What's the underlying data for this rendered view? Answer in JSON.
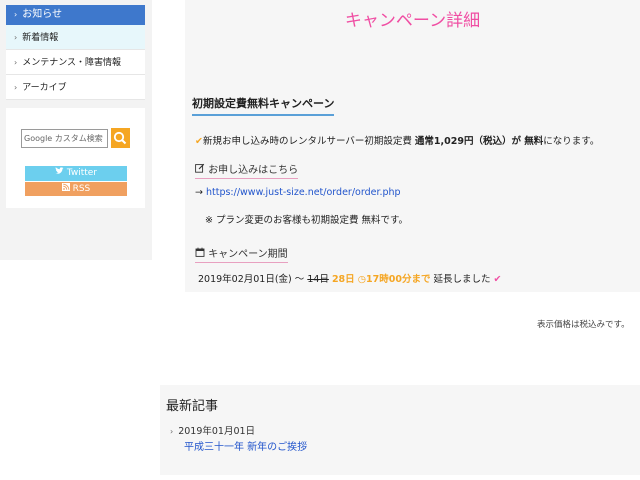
{
  "sidebar": {
    "menu_header": "お知らせ",
    "items": [
      {
        "label": "新着情報"
      },
      {
        "label": "メンテナンス・障害情報"
      },
      {
        "label": "アーカイブ"
      }
    ],
    "search": {
      "placeholder": "Google カスタム検索"
    },
    "twitter_label": "Twitter",
    "rss_label": "RSS"
  },
  "main": {
    "title": "キャンペーン詳細",
    "section_heading": "初期設定費無料キャンペーン",
    "line1": {
      "prefix": "新規お申し込み時のレンタルサーバー初期設定費 ",
      "price": "通常1,029円（税込）が 無料",
      "suffix": "になります。"
    },
    "apply_heading": "お申し込みはこちら",
    "apply_link": "https://www.just-size.net/order/order.php",
    "note": "※ プラン変更のお客様も初期設定費 無料です。",
    "period_heading": "キャンペーン期間",
    "period": {
      "start": "2019年02月01日(金) ～ ",
      "old_end": "14日",
      "new_end": "28日",
      "time": "17時00分まで",
      "suffix": "延長しました"
    },
    "tax_note": "表示価格は税込みです。"
  },
  "recent": {
    "title": "最新記事",
    "date": "2019年01月01日",
    "link": "平成三十一年 新年のご挨拶"
  },
  "colors": {
    "accent_pink": "#f04ea3",
    "accent_orange": "#f5a623",
    "menu_blue": "#3e78cc",
    "link_blue": "#2255cc"
  }
}
